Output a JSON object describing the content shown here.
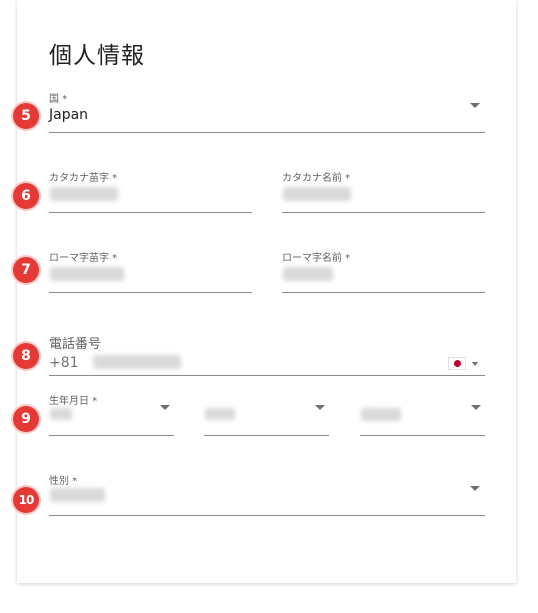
{
  "form": {
    "title": "個人情報",
    "country": {
      "label": "国 *",
      "value": "Japan"
    },
    "katakana_last": {
      "label": "カタカナ苗字 *"
    },
    "katakana_first": {
      "label": "カタカナ名前 *"
    },
    "roman_last": {
      "label": "ローマ字苗字 *"
    },
    "roman_first": {
      "label": "ローマ字名前 *"
    },
    "phone": {
      "label": "電話番号",
      "country_code": "+81",
      "flag_icon": "japan-flag-icon"
    },
    "birthdate": {
      "label": "生年月日 *"
    },
    "gender": {
      "label": "性別 *"
    }
  },
  "badges": [
    "5",
    "6",
    "7",
    "8",
    "9",
    "10"
  ],
  "colors": {
    "badge": "#e53935",
    "line": "#8a8a8a",
    "flag_circle": "#bc002d"
  }
}
